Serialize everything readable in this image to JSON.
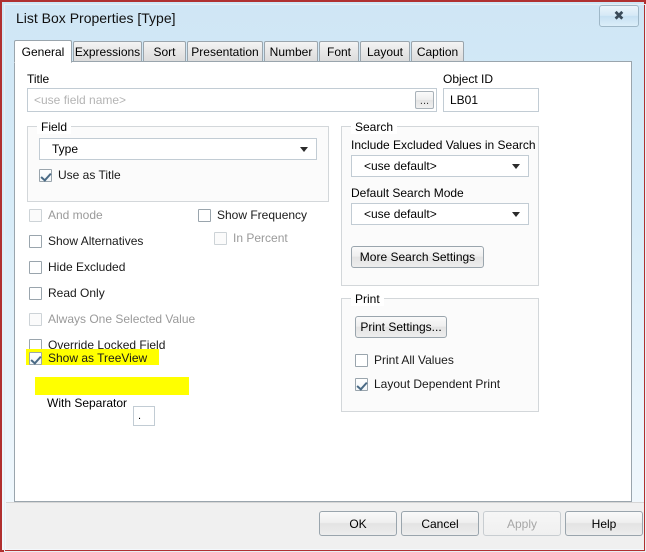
{
  "window": {
    "title": "List Box Properties [Type]",
    "close_icon": "close-icon",
    "close_glyph": "✖"
  },
  "tabs": [
    {
      "label": "General",
      "active": true
    },
    {
      "label": "Expressions",
      "active": false
    },
    {
      "label": "Sort",
      "active": false
    },
    {
      "label": "Presentation",
      "active": false
    },
    {
      "label": "Number",
      "active": false
    },
    {
      "label": "Font",
      "active": false
    },
    {
      "label": "Layout",
      "active": false
    },
    {
      "label": "Caption",
      "active": false
    }
  ],
  "general": {
    "title_label": "Title",
    "title_value": "",
    "title_placeholder": "<use field name>",
    "browse_button": "...",
    "object_id_label": "Object ID",
    "object_id_value": "LB01",
    "field_group": {
      "legend": "Field",
      "field_value": "Type",
      "use_as_title": {
        "label": "Use as Title",
        "checked": true,
        "enabled": true
      }
    },
    "options_left": [
      {
        "label": "And mode",
        "checked": false,
        "enabled": false
      },
      {
        "label": "Show Alternatives",
        "checked": false,
        "enabled": true
      },
      {
        "label": "Hide Excluded",
        "checked": false,
        "enabled": true
      },
      {
        "label": "Read Only",
        "checked": false,
        "enabled": true
      },
      {
        "label": "Always One Selected Value",
        "checked": false,
        "enabled": false
      },
      {
        "label": "Override Locked Field",
        "checked": false,
        "enabled": true
      },
      {
        "label": "Show as TreeView",
        "checked": true,
        "enabled": true,
        "highlighted": true
      }
    ],
    "separator_row": {
      "label": "With Separator",
      "value": ".",
      "highlighted": true
    },
    "options_right": [
      {
        "label": "Show Frequency",
        "checked": false,
        "enabled": true
      },
      {
        "label": "In Percent",
        "checked": false,
        "enabled": false
      }
    ],
    "search_group": {
      "legend": "Search",
      "include_excluded_label": "Include Excluded Values in Search",
      "include_excluded_value": "<use default>",
      "default_search_mode_label": "Default Search Mode",
      "default_search_mode_value": "<use default>",
      "more_settings_button": "More Search Settings"
    },
    "print_group": {
      "legend": "Print",
      "print_settings_button": "Print Settings...",
      "print_all_values": {
        "label": "Print All Values",
        "checked": false,
        "enabled": true
      },
      "layout_dependent_print": {
        "label": "Layout Dependent Print",
        "checked": true,
        "enabled": true
      }
    }
  },
  "footer": {
    "ok": "OK",
    "cancel": "Cancel",
    "apply": "Apply",
    "help": "Help"
  },
  "colors": {
    "highlight": "#ffff00",
    "window_border": "#b03030",
    "titlebar": "#d2e8f6"
  }
}
